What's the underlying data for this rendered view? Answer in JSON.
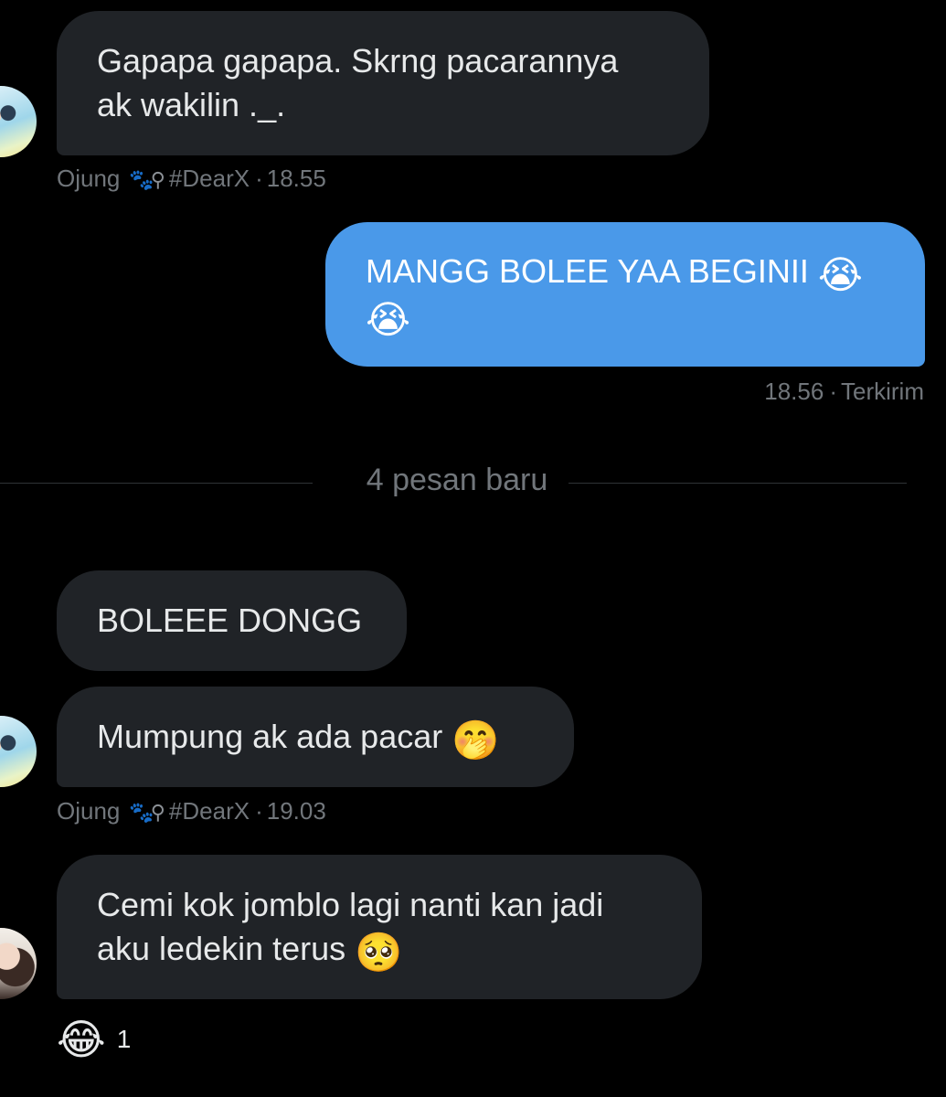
{
  "messages": [
    {
      "text": "Gapapa gapapa. Skrng pacarannya\nak wakilin ._.",
      "meta": {
        "sender": "Ojung",
        "tag": "#DearX",
        "time": "18.55"
      }
    },
    {
      "text": "MANGG BOLEE YAA BEGINII ",
      "emoji1": "😭",
      "emoji2": "😭",
      "meta": {
        "time": "18.56",
        "status": "Terkirim"
      }
    },
    {
      "text": "BOLEEE DONGG"
    },
    {
      "text": "Mumpung ak ada pacar ",
      "emoji": "🤭",
      "meta": {
        "sender": "Ojung",
        "tag": "#DearX",
        "time": "19.03"
      }
    },
    {
      "text": "Cemi kok jomblo lagi nanti kan jadi\naku ledekin terus ",
      "emoji": "🥺",
      "reaction": {
        "emoji": "😂",
        "count": "1"
      }
    }
  ],
  "divider": {
    "label": "4 pesan baru"
  },
  "colors": {
    "background": "#000000",
    "incoming_bubble": "#202327",
    "outgoing_bubble": "#4a99e9",
    "meta_text": "#71767b"
  },
  "icons": {
    "sender_badge": "paw-prints-icon"
  }
}
